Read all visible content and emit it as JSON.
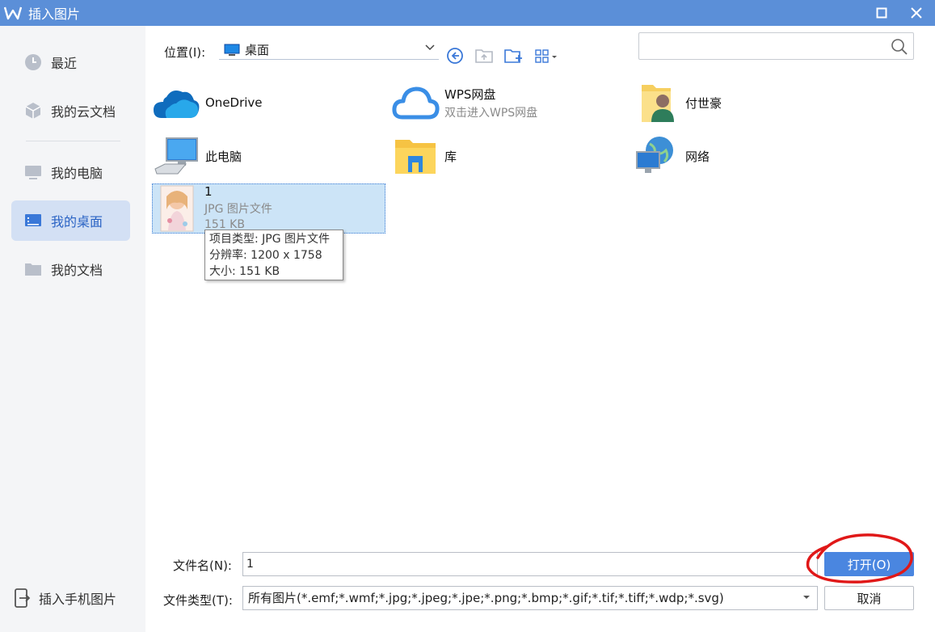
{
  "window": {
    "title": "插入图片",
    "accent": "#5b8fd8"
  },
  "sidebar": {
    "items": [
      {
        "label": "最近",
        "icon": "clock-icon"
      },
      {
        "label": "我的云文档",
        "icon": "cloud-doc-icon"
      },
      {
        "label": "我的电脑",
        "icon": "computer-icon"
      },
      {
        "label": "我的桌面",
        "icon": "desktop-icon",
        "active": true
      },
      {
        "label": "我的文档",
        "icon": "folder-icon"
      }
    ],
    "bottom_label": "插入手机图片"
  },
  "location": {
    "label": "位置(I):",
    "value": "桌面"
  },
  "items": [
    {
      "name": "OneDrive",
      "sub": ""
    },
    {
      "name": "WPS网盘",
      "sub": "双击进入WPS网盘"
    },
    {
      "name": "付世豪",
      "sub": ""
    },
    {
      "name": "此电脑",
      "sub": ""
    },
    {
      "name": "库",
      "sub": ""
    },
    {
      "name": "网络",
      "sub": ""
    },
    {
      "name": "1",
      "type": "JPG 图片文件",
      "size": "151 KB",
      "selected": true
    }
  ],
  "tooltip": {
    "line1": "项目类型: JPG 图片文件",
    "line2": "分辨率: 1200 x 1758",
    "line3": "大小: 151 KB"
  },
  "form": {
    "filename_label": "文件名(N):",
    "filename_value": "1",
    "filetype_label": "文件类型(T):",
    "filetype_value": "所有图片(*.emf;*.wmf;*.jpg;*.jpeg;*.jpe;*.png;*.bmp;*.gif;*.tif;*.tiff;*.wdp;*.svg)",
    "open_label": "打开(O)",
    "cancel_label": "取消"
  }
}
